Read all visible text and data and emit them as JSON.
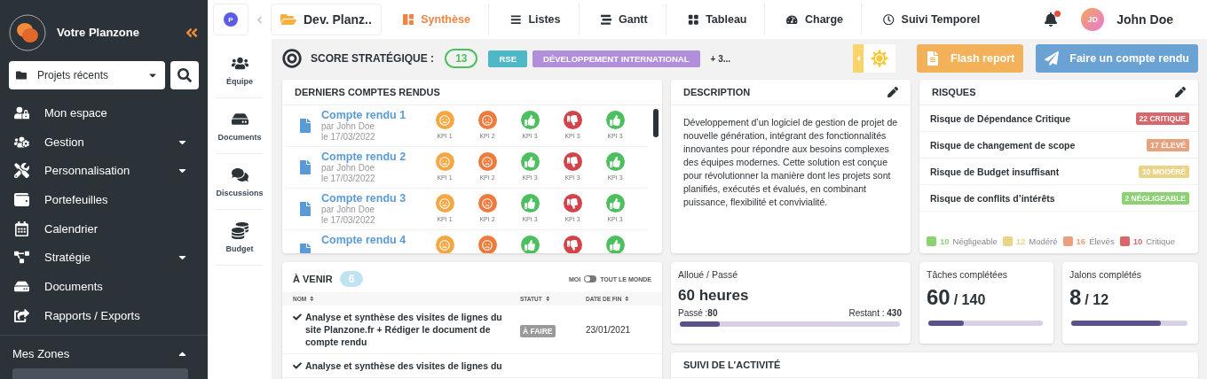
{
  "sidebar": {
    "brand": "Votre Planzone",
    "recent_projects": "Projets récents",
    "items": [
      {
        "label": "Mon espace",
        "has_submenu": false
      },
      {
        "label": "Gestion",
        "has_submenu": true
      },
      {
        "label": "Personnalisation",
        "has_submenu": true
      },
      {
        "label": "Portefeuilles",
        "has_submenu": false
      },
      {
        "label": "Calendrier",
        "has_submenu": false
      },
      {
        "label": "Stratégie",
        "has_submenu": true
      },
      {
        "label": "Documents",
        "has_submenu": false
      },
      {
        "label": "Rapports / Exports",
        "has_submenu": false
      }
    ],
    "zones": {
      "label": "Mes Zones",
      "expanded": true
    }
  },
  "topbar": {
    "workspace_badge": "P",
    "project": "Dev. Planz..",
    "tabs": [
      {
        "label": "Synthèse",
        "selected": true
      },
      {
        "label": "Listes",
        "selected": false
      },
      {
        "label": "Gantt",
        "selected": false
      },
      {
        "label": "Tableau",
        "selected": false
      },
      {
        "label": "Charge",
        "selected": false
      },
      {
        "label": "Suivi Temporel",
        "selected": false
      }
    ],
    "notifications_unread": true,
    "user": {
      "initials": "JD",
      "name": "John Doe"
    }
  },
  "project_nav": [
    {
      "label": "Équipe"
    },
    {
      "label": "Documents"
    },
    {
      "label": "Discussions"
    },
    {
      "label": "Budget"
    }
  ],
  "weather": {
    "kind": "sunny"
  },
  "score": {
    "label": "SCORE STRATÉGIQUE :",
    "value": "13",
    "tags": [
      {
        "label": "RSE",
        "color": "#4fb8c6"
      },
      {
        "label": "DÉVELOPPEMENT INTERNATIONAL",
        "color": "#b18fdb"
      }
    ],
    "more": "+ 3..."
  },
  "actions": {
    "flash_report": "Flash report",
    "compte_rendu": "Faire un compte rendu"
  },
  "reports": {
    "title": "DERNIERS COMPTES RENDUS",
    "items": [
      {
        "title": "Compte rendu 1",
        "author": "par John Doe",
        "date": "le 17/03/2022",
        "kpis": [
          {
            "kind": "neutral",
            "label": "KPI 1"
          },
          {
            "kind": "sad",
            "label": "KPI 2"
          },
          {
            "kind": "up",
            "label": "KPI 3"
          },
          {
            "kind": "down",
            "label": "KPI 3"
          },
          {
            "kind": "up",
            "label": "KPI 3"
          }
        ]
      },
      {
        "title": "Compte rendu 2",
        "author": "par John Doe",
        "date": "le 17/03/2022",
        "kpis": [
          {
            "kind": "neutral",
            "label": "KPI 1"
          },
          {
            "kind": "sad",
            "label": "KPI 2"
          },
          {
            "kind": "up",
            "label": "KPI 3"
          },
          {
            "kind": "down",
            "label": "KPI 3"
          },
          {
            "kind": "up",
            "label": "KPI 3"
          }
        ]
      },
      {
        "title": "Compte rendu 3",
        "author": "par John Doe",
        "date": "le 17/03/2022",
        "kpis": [
          {
            "kind": "neutral",
            "label": "KPI 1"
          },
          {
            "kind": "sad",
            "label": "KPI 2"
          },
          {
            "kind": "up",
            "label": "KPI 3"
          },
          {
            "kind": "down",
            "label": "KPI 3"
          },
          {
            "kind": "up",
            "label": "KPI 3"
          }
        ]
      },
      {
        "title": "Compte rendu 4",
        "kpis": [
          {
            "kind": "neutral"
          },
          {
            "kind": "sad"
          },
          {
            "kind": "up"
          },
          {
            "kind": "down"
          },
          {
            "kind": "up"
          }
        ]
      }
    ]
  },
  "description": {
    "title": "DESCRIPTION",
    "text": "Développement d’un logiciel de gestion de projet de nouvelle génération, intégrant des fonctionnalités innovantes pour répondre aux besoins complexes des équipes modernes. Cette solution est conçue pour révolutionner la manière dont les projets sont planifiés, exécutés et évalués, en combinant puissance, flexibilité et convivialité."
  },
  "risks": {
    "title": "RISQUES",
    "items": [
      {
        "name": "Risque de Dépendance Critique",
        "badge": "22 CRITIQUE",
        "color": "#d9666b"
      },
      {
        "name": "Risque de changement de scope",
        "badge": "17 ÉLEVÉ",
        "color": "#e9a07c"
      },
      {
        "name": "Risque de Budget insuffisant",
        "badge": "10 MODÉRÉ",
        "color": "#ead488"
      },
      {
        "name": "Risque de conflits d’intérêts",
        "badge": "2 NÉGLIGEABLE",
        "color": "#8dd175"
      }
    ],
    "legend": [
      {
        "count": "10",
        "label": "Négligeable",
        "color": "#8dd175"
      },
      {
        "count": "12",
        "label": "Modéré",
        "color": "#ead488"
      },
      {
        "count": "16",
        "label": "Élevés",
        "color": "#e9a07c"
      },
      {
        "count": "10",
        "label": "Critique",
        "color": "#d9666b"
      }
    ]
  },
  "upcoming": {
    "title": "À VENIR",
    "count": "6",
    "toggle": {
      "left": "MOI",
      "right": "TOUT LE MONDE",
      "on": false
    },
    "columns": [
      "NOM",
      "STATUT",
      "DATE DE FIN"
    ],
    "rows": [
      {
        "name": "Analyse et synthèse des visites de lignes du site Planzone.fr + Rédiger le document de compte rendu",
        "status": "À FAIRE",
        "date": "23/01/2021",
        "done": true
      },
      {
        "name": "Analyse et synthèse des visites de lignes du",
        "done": true
      }
    ]
  },
  "hours": {
    "label": "Alloué / Passé",
    "value": "60 heures",
    "spent_label": "Passé :",
    "spent": "80",
    "remaining_label": "Restant :",
    "remaining": "430",
    "level": 0.18
  },
  "tasks": {
    "label": "Tâches complétées",
    "done": "60",
    "total": "/ 140",
    "level": 0.31
  },
  "milestones": {
    "label": "Jalons complétés",
    "done": "8",
    "total": "/ 12",
    "level": 0.77
  },
  "activity": {
    "title": "SUIVI DE L’ACTIVITÉ"
  }
}
